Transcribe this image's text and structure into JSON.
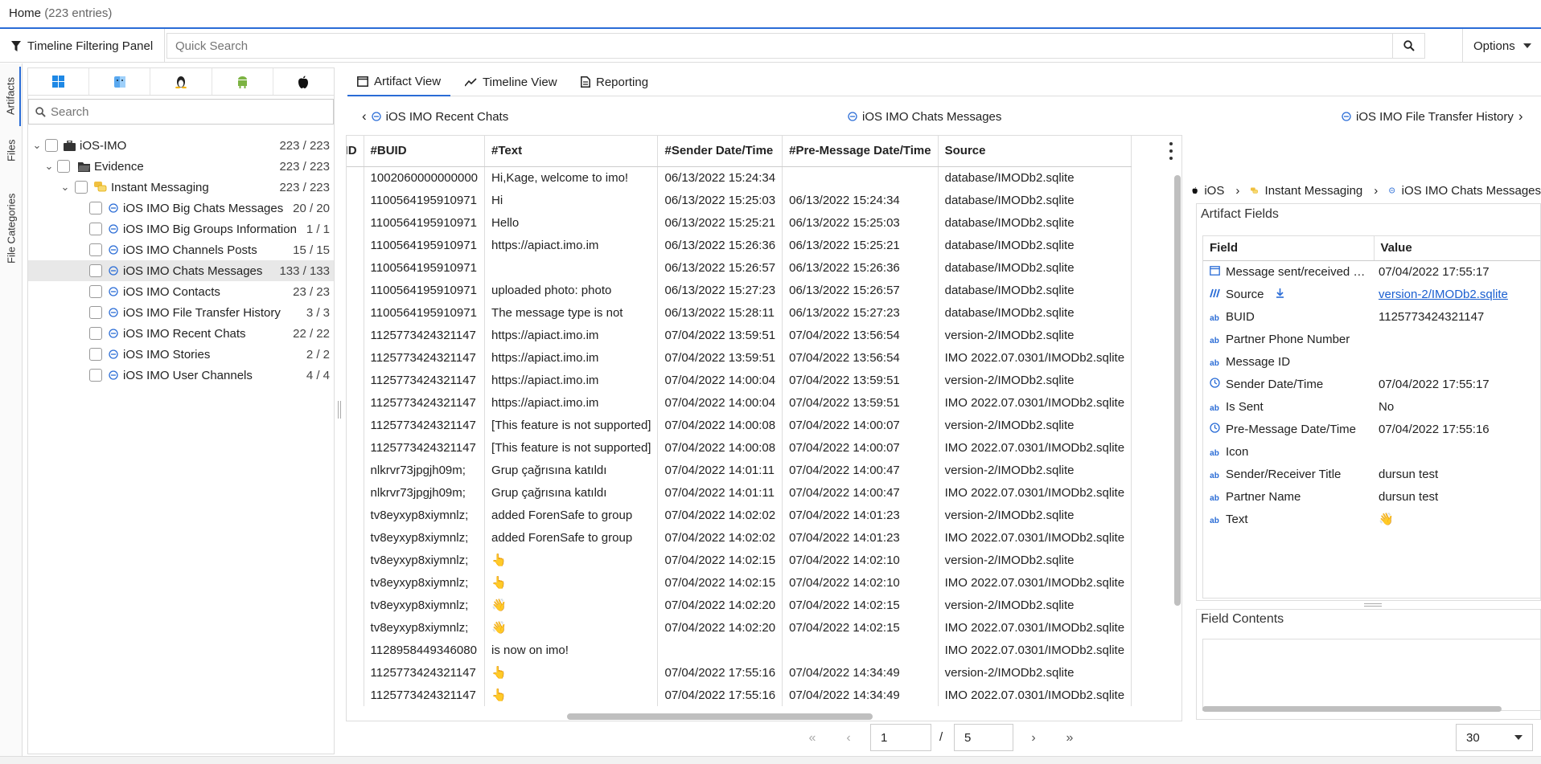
{
  "home": {
    "title": "Home",
    "entries": "(223 entries)"
  },
  "toolbar": {
    "filter_panel_label": "Timeline Filtering Panel",
    "search_placeholder": "Quick Search",
    "options_label": "Options"
  },
  "side_tabs": [
    "Artifacts",
    "Files",
    "File Categories"
  ],
  "left": {
    "os_icons": [
      "windows-icon",
      "macos-finder-icon",
      "linux-icon",
      "android-icon",
      "apple-icon"
    ],
    "search_placeholder": "Search",
    "tree": [
      {
        "label": "iOS-IMO",
        "count": "223 / 223",
        "icon": "briefcase-icon",
        "level": 0
      },
      {
        "label": "Evidence",
        "count": "223 / 223",
        "icon": "folder-icon",
        "level": 1
      },
      {
        "label": "Instant Messaging",
        "count": "223 / 223",
        "icon": "chat-icon",
        "level": 2
      },
      {
        "label": "iOS IMO Big Chats Messages",
        "count": "20 / 20",
        "level": 3
      },
      {
        "label": "iOS IMO Big Groups Information",
        "count": "1 / 1",
        "level": 3
      },
      {
        "label": "iOS IMO Channels Posts",
        "count": "15 / 15",
        "level": 3
      },
      {
        "label": "iOS IMO Chats Messages",
        "count": "133 / 133",
        "level": 3,
        "selected": true
      },
      {
        "label": "iOS IMO Contacts",
        "count": "23 / 23",
        "level": 3
      },
      {
        "label": "iOS IMO File Transfer History",
        "count": "3 / 3",
        "level": 3
      },
      {
        "label": "iOS IMO Recent Chats",
        "count": "22 / 22",
        "level": 3
      },
      {
        "label": "iOS IMO Stories",
        "count": "2 / 2",
        "level": 3
      },
      {
        "label": "iOS IMO User Channels",
        "count": "4 / 4",
        "level": 3
      }
    ]
  },
  "tabs": {
    "artifact": "Artifact View",
    "timeline": "Timeline View",
    "reporting": "Reporting"
  },
  "crumbs": {
    "prev": "iOS IMO Recent Chats",
    "current": "iOS IMO Chats Messages",
    "next": "iOS IMO File Transfer History"
  },
  "grid": {
    "columns": [
      "Message ID",
      "#BUID",
      "#Text",
      "#Sender Date/Time",
      "#Pre-Message Date/Time",
      "Source"
    ],
    "rows": [
      [
        "",
        "1002060000000000",
        "Hi,Kage, welcome to imo!",
        "06/13/2022 15:24:34",
        "",
        "database/IMODb2.sqlite"
      ],
      [
        "",
        "1100564195910971",
        "Hi",
        "06/13/2022 15:25:03",
        "06/13/2022 15:24:34",
        "database/IMODb2.sqlite"
      ],
      [
        "",
        "1100564195910971",
        "Hello",
        "06/13/2022 15:25:21",
        "06/13/2022 15:25:03",
        "database/IMODb2.sqlite"
      ],
      [
        "",
        "1100564195910971",
        "https://apiact.imo.im",
        "06/13/2022 15:26:36",
        "06/13/2022 15:25:21",
        "database/IMODb2.sqlite"
      ],
      [
        "",
        "1100564195910971",
        "",
        "06/13/2022 15:26:57",
        "06/13/2022 15:26:36",
        "database/IMODb2.sqlite"
      ],
      [
        "",
        "1100564195910971",
        "uploaded photo: photo",
        "06/13/2022 15:27:23",
        "06/13/2022 15:26:57",
        "database/IMODb2.sqlite"
      ],
      [
        "",
        "1100564195910971",
        "The message type is not",
        "06/13/2022 15:28:11",
        "06/13/2022 15:27:23",
        "database/IMODb2.sqlite"
      ],
      [
        "",
        "1125773424321147",
        "https://apiact.imo.im",
        "07/04/2022 13:59:51",
        "07/04/2022 13:56:54",
        "version-2/IMODb2.sqlite"
      ],
      [
        "",
        "1125773424321147",
        "https://apiact.imo.im",
        "07/04/2022 13:59:51",
        "07/04/2022 13:56:54",
        "IMO 2022.07.0301/IMODb2.sqlite"
      ],
      [
        "",
        "1125773424321147",
        "https://apiact.imo.im",
        "07/04/2022 14:00:04",
        "07/04/2022 13:59:51",
        "version-2/IMODb2.sqlite"
      ],
      [
        "",
        "1125773424321147",
        "https://apiact.imo.im",
        "07/04/2022 14:00:04",
        "07/04/2022 13:59:51",
        "IMO 2022.07.0301/IMODb2.sqlite"
      ],
      [
        "",
        "1125773424321147",
        "[This feature is not supported]",
        "07/04/2022 14:00:08",
        "07/04/2022 14:00:07",
        "version-2/IMODb2.sqlite"
      ],
      [
        "",
        "1125773424321147",
        "[This feature is not supported]",
        "07/04/2022 14:00:08",
        "07/04/2022 14:00:07",
        "IMO 2022.07.0301/IMODb2.sqlite"
      ],
      [
        "",
        "nlkrvr73jpgjh09m;",
        "Grup çağrısına katıldı",
        "07/04/2022 14:01:11",
        "07/04/2022 14:00:47",
        "version-2/IMODb2.sqlite"
      ],
      [
        "",
        "nlkrvr73jpgjh09m;",
        "Grup çağrısına katıldı",
        "07/04/2022 14:01:11",
        "07/04/2022 14:00:47",
        "IMO 2022.07.0301/IMODb2.sqlite"
      ],
      [
        "",
        "tv8eyxyp8xiymnlz;",
        "added ForenSafe to group",
        "07/04/2022 14:02:02",
        "07/04/2022 14:01:23",
        "version-2/IMODb2.sqlite"
      ],
      [
        "",
        "tv8eyxyp8xiymnlz;",
        "added ForenSafe to group",
        "07/04/2022 14:02:02",
        "07/04/2022 14:01:23",
        "IMO 2022.07.0301/IMODb2.sqlite"
      ],
      [
        "",
        "tv8eyxyp8xiymnlz;",
        "👆",
        "07/04/2022 14:02:15",
        "07/04/2022 14:02:10",
        "version-2/IMODb2.sqlite"
      ],
      [
        "",
        "tv8eyxyp8xiymnlz;",
        "👆",
        "07/04/2022 14:02:15",
        "07/04/2022 14:02:10",
        "IMO 2022.07.0301/IMODb2.sqlite"
      ],
      [
        "",
        "tv8eyxyp8xiymnlz;",
        "👋",
        "07/04/2022 14:02:20",
        "07/04/2022 14:02:15",
        "version-2/IMODb2.sqlite"
      ],
      [
        "",
        "tv8eyxyp8xiymnlz;",
        "👋",
        "07/04/2022 14:02:20",
        "07/04/2022 14:02:15",
        "IMO 2022.07.0301/IMODb2.sqlite"
      ],
      [
        "",
        "1128958449346080",
        "is now on imo!",
        "",
        "",
        "IMO 2022.07.0301/IMODb2.sqlite"
      ],
      [
        "",
        "1125773424321147",
        "👆",
        "07/04/2022 17:55:16",
        "07/04/2022 14:34:49",
        "version-2/IMODb2.sqlite"
      ],
      [
        "",
        "1125773424321147",
        "👆",
        "07/04/2022 17:55:16",
        "07/04/2022 14:34:49",
        "IMO 2022.07.0301/IMODb2.sqlite"
      ]
    ]
  },
  "details": {
    "crumbs": [
      "iOS",
      "Instant Messaging",
      "iOS IMO Chats Messages"
    ],
    "artifact_fields_title": "Artifact Fields",
    "headers": [
      "Field",
      "Value"
    ],
    "fields": [
      {
        "icon": "calendar-icon",
        "name": "Message sent/received Date/Time",
        "value": "07/04/2022 17:55:17"
      },
      {
        "icon": "source-icon",
        "name": "Source",
        "value": "version-2/IMODb2.sqlite",
        "link": true
      },
      {
        "icon": "ab-icon",
        "name": "BUID",
        "value": "1125773424321147"
      },
      {
        "icon": "ab-icon",
        "name": "Partner Phone Number",
        "value": ""
      },
      {
        "icon": "ab-icon",
        "name": "Message ID",
        "value": ""
      },
      {
        "icon": "clock-icon",
        "name": "Sender Date/Time",
        "value": "07/04/2022 17:55:17"
      },
      {
        "icon": "ab-icon",
        "name": "Is Sent",
        "value": "No"
      },
      {
        "icon": "clock-icon",
        "name": "Pre-Message Date/Time",
        "value": "07/04/2022 17:55:16"
      },
      {
        "icon": "ab-icon",
        "name": "Icon",
        "value": ""
      },
      {
        "icon": "ab-icon",
        "name": "Sender/Receiver Title",
        "value": "dursun test"
      },
      {
        "icon": "ab-icon",
        "name": "Partner Name",
        "value": "dursun test"
      },
      {
        "icon": "ab-icon",
        "name": "Text",
        "value": "👋"
      }
    ],
    "field_contents_title": "Field Contents"
  },
  "pager": {
    "page": "1",
    "separator": "/",
    "total": "5",
    "page_size": "30"
  }
}
